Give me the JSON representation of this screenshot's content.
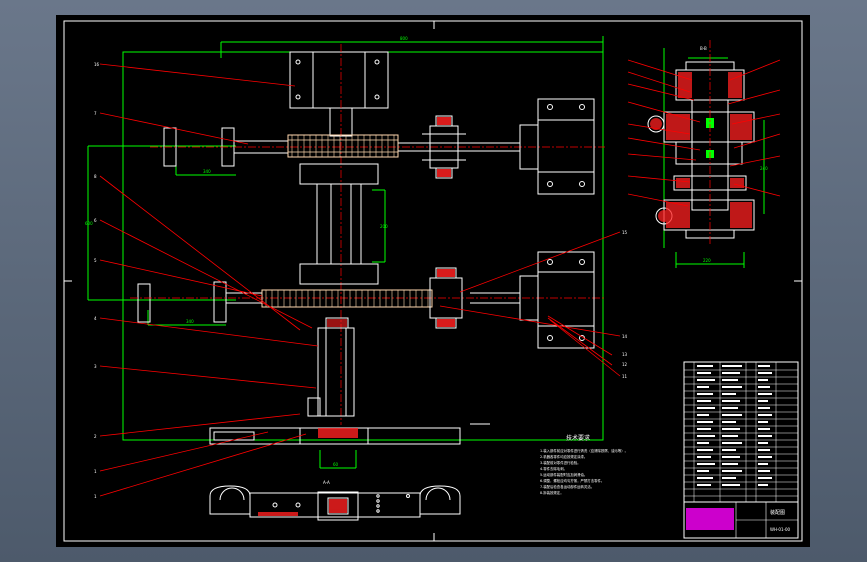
{
  "drawing": {
    "section_label": "B-B",
    "lower_section_label": "A-A",
    "title_block_name": "装配图",
    "title_block_code": "WH-01-00"
  },
  "tech_req": {
    "title": "技术要求",
    "lines": [
      "1.装入部件前应对零件进行清洗（应清除铁屑、油污等）。",
      "2.机器各零件均应按规定涂漆。",
      "3.装配前对零件进行检验。",
      "4.零件去除毛刺。",
      "5.运动部件装配时应加润滑油。",
      "6.调整，螺栓应均匀拧紧，严禁打击零件。",
      "7.装配后检查各运动部件运转灵活。",
      "8.拆装按规定。"
    ]
  },
  "colors": {
    "background": "#000000",
    "window": "#5f6c7c",
    "border": "#ffffff",
    "part": "#ffffff",
    "dimension": "#00ff00",
    "leader": "#ff0000",
    "gear": "#ffd9b0",
    "hatch": "#ff2020",
    "centerline": "#ff0000",
    "table_fill": "#ff00ff"
  }
}
